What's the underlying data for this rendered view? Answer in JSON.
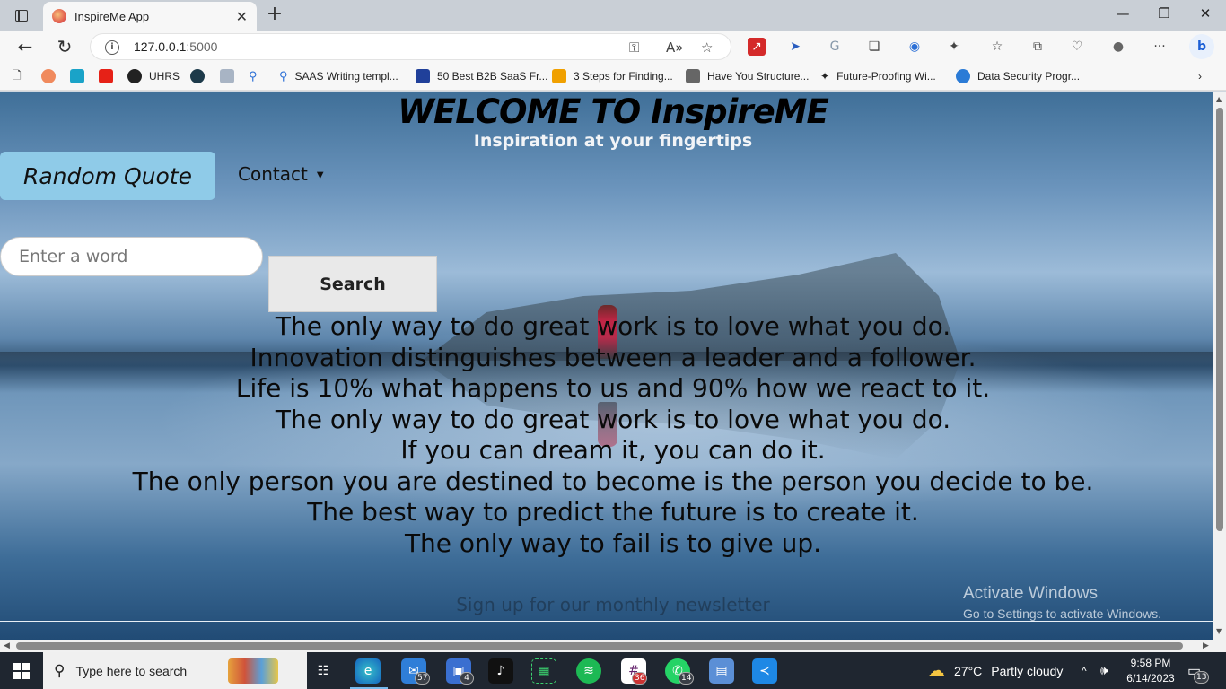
{
  "browser": {
    "tab_title": "InspireMe App",
    "url_host": "127.0.0.1",
    "url_port": ":5000",
    "bookmarks": [
      {
        "label": "",
        "icon": "tk-icon",
        "color": "#1aa3c8"
      },
      {
        "label": "",
        "icon": "youtube-icon",
        "color": "#e62117"
      },
      {
        "label": "UHRS",
        "icon": "uhrs-icon",
        "color": "#222222"
      },
      {
        "label": "",
        "icon": "sk-icon",
        "color": "#1d3a4a"
      },
      {
        "label": "",
        "icon": "bird-icon",
        "color": "#7a8aa0"
      },
      {
        "label": "",
        "icon": "search-icon",
        "color": "#2b6fd6"
      },
      {
        "label": "SAAS Writing templ...",
        "icon": "search-icon",
        "color": "#2b6fd6"
      },
      {
        "label": "50 Best B2B SaaS Fr...",
        "icon": "doc-icon",
        "color": "#20409a"
      },
      {
        "label": "3 Steps for Finding...",
        "icon": "leaf-icon",
        "color": "#f0a000"
      },
      {
        "label": "Have You Structure...",
        "icon": "secb-icon",
        "color": "#444444"
      },
      {
        "label": "Future-Proofing Wi...",
        "icon": "star-icon",
        "color": "#111111"
      },
      {
        "label": "Data Security Progr...",
        "icon": "globe-icon",
        "color": "#2b7bd6"
      }
    ]
  },
  "page": {
    "title": "WELCOME TO InspireME",
    "subtitle": "Inspiration at your fingertips",
    "nav": {
      "random_quote": "Random Quote",
      "contact": "Contact"
    },
    "search": {
      "placeholder": "Enter a word",
      "button": "Search"
    },
    "quotes": [
      "The only way to do great work is to love what you do.",
      "Innovation distinguishes between a leader and a follower.",
      "Life is 10% what happens to us and 90% how we react to it.",
      "The only way to do great work is to love what you do.",
      "If you can dream it, you can do it.",
      "The only person you are destined to become is the person you decide to be.",
      "The best way to predict the future is to create it.",
      "The only way to fail is to give up."
    ],
    "newsletter": "Sign up for our monthly newsletter",
    "watermark": {
      "line1": "Activate Windows",
      "line2": "Go to Settings to activate Windows."
    }
  },
  "taskbar": {
    "search_placeholder": "Type here to search",
    "apps": [
      {
        "icon": "file-explorer-icon",
        "badge": ""
      },
      {
        "icon": "task-view-icon",
        "badge": ""
      },
      {
        "icon": "edge-icon",
        "badge": ""
      },
      {
        "icon": "mail-icon",
        "badge": "57"
      },
      {
        "icon": "store-icon",
        "badge": "4"
      },
      {
        "icon": "tiktok-icon",
        "badge": ""
      },
      {
        "icon": "grid-app-icon",
        "badge": ""
      },
      {
        "icon": "spotify-icon",
        "badge": ""
      },
      {
        "icon": "slack-icon",
        "badge": "36"
      },
      {
        "icon": "whatsapp-icon",
        "badge": "14"
      },
      {
        "icon": "remote-desktop-icon",
        "badge": ""
      },
      {
        "icon": "vscode-icon",
        "badge": ""
      }
    ],
    "weather": {
      "temp": "27°C",
      "condition": "Partly cloudy"
    },
    "time": "9:58 PM",
    "date": "6/14/2023",
    "notifications": "13"
  }
}
